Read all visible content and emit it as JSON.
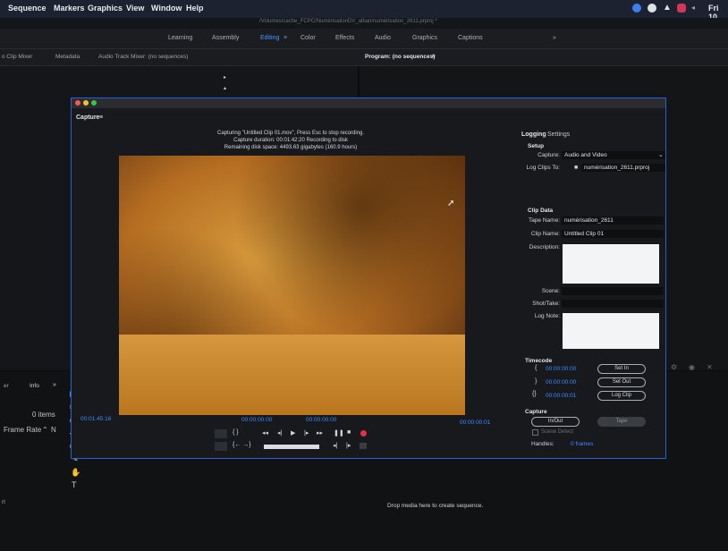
{
  "menubar": {
    "items": [
      "Sequence",
      "Markers",
      "Graphics",
      "View",
      "Window",
      "Help"
    ],
    "clock": "Fri 10"
  },
  "title": {
    "path": "/Volumes/cache_FCPC/NumérisationDV_alban/numérisation_2611.prproj *"
  },
  "workspaces": [
    "Learning",
    "Assembly",
    "Editing",
    "Color",
    "Effects",
    "Audio",
    "Graphics",
    "Captions",
    "»"
  ],
  "panels": {
    "left_tabs": [
      "o Clip Mixer",
      "Metadata",
      "Audio Track Mixer: (no sequences)"
    ],
    "program_title": "Program: (no sequences)",
    "project_tab": "Info",
    "chevron": "»",
    "items_count": "0 items",
    "frame_rate": "Frame Rate",
    "drop_text": "Drop media here to create sequence.",
    "edge_label_1": "er",
    "edge_label_2": "rt"
  },
  "capture": {
    "title": "Capture",
    "status_line1": "Capturing \"Untitled Clip 01.mov\", Press Esc to stop recording.",
    "status_line2": "Capture duration: 00:01:42:20  Recording to disk",
    "status_line3": "Remaining disk space: 4493.63 gigabytes (160.9 hours)",
    "timecode_current": "00:01:45:16",
    "in_point": "00:00:00:00",
    "out_point": "00:00:00:00",
    "duration": "00:00:00:01",
    "logging_tab": "Logging",
    "settings_tab": "Settings",
    "setup_heading": "Setup",
    "capture_label": "Capture:",
    "capture_value": "Audio and Video",
    "logclips_label": "Log Clips To:",
    "logclips_value": "numérisation_2611.prproj",
    "clipdata_heading": "Clip Data",
    "tape_label": "Tape Name:",
    "tape_value": "numérisation_2611",
    "clip_label": "Clip Name:",
    "clip_value": "Untitled Clip 01",
    "desc_label": "Description:",
    "scene_label": "Scene:",
    "shot_label": "Shot/Take:",
    "lognote_label": "Log Note:",
    "timecode_heading": "Timecode",
    "tc_in": "00:00:00:00",
    "tc_out": "00:00:00:00",
    "tc_dur": "00:00:00:01",
    "set_in": "Set In",
    "set_out": "Set Out",
    "log_clip": "Log Clip",
    "capture_heading": "Capture",
    "inout_btn": "In/Out",
    "tape_btn": "Tape",
    "scene_detect": "Scene Detect",
    "handles_label": "Handles:",
    "handles_value": "0 frames"
  },
  "colors": {
    "accent": "#2a5fd6",
    "timecode": "#3e8cff",
    "record": "#e0324b"
  }
}
